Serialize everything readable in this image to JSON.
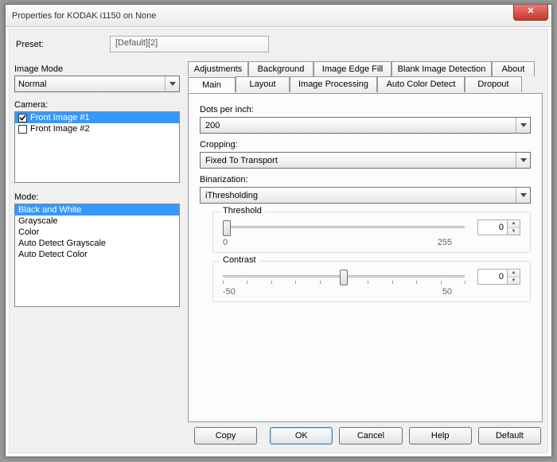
{
  "window": {
    "title": "Properties for KODAK i1150 on None"
  },
  "preset": {
    "label": "Preset:",
    "value": "[Default][2]"
  },
  "left": {
    "imageModeLabel": "Image Mode",
    "imageModeValue": "Normal",
    "cameraLabel": "Camera:",
    "cameraItems": [
      {
        "label": "Front Image #1",
        "checked": true,
        "selected": true
      },
      {
        "label": "Front Image #2",
        "checked": false,
        "selected": false
      }
    ],
    "modeLabel": "Mode:",
    "modeItems": [
      {
        "label": "Black and White",
        "selected": true
      },
      {
        "label": "Grayscale",
        "selected": false
      },
      {
        "label": "Color",
        "selected": false
      },
      {
        "label": "Auto Detect Grayscale",
        "selected": false
      },
      {
        "label": "Auto Detect Color",
        "selected": false
      }
    ]
  },
  "tabs": {
    "upper": [
      "Adjustments",
      "Background",
      "Image Edge Fill",
      "Blank Image Detection",
      "About"
    ],
    "lower": [
      "Main",
      "Layout",
      "Image Processing",
      "Auto Color Detect",
      "Dropout"
    ],
    "activeLower": 0
  },
  "main": {
    "dpiLabel": "Dots per inch:",
    "dpiValue": "200",
    "croppingLabel": "Cropping:",
    "croppingValue": "Fixed To Transport",
    "binarizationLabel": "Binarization:",
    "binarizationValue": "iThresholding",
    "threshold": {
      "label": "Threshold",
      "value": "0",
      "min": "0",
      "max": "255",
      "pos": 0
    },
    "contrast": {
      "label": "Contrast",
      "value": "0",
      "min": "-50",
      "max": "50",
      "pos": 50
    }
  },
  "buttons": {
    "copy": "Copy",
    "ok": "OK",
    "cancel": "Cancel",
    "help": "Help",
    "default": "Default"
  }
}
